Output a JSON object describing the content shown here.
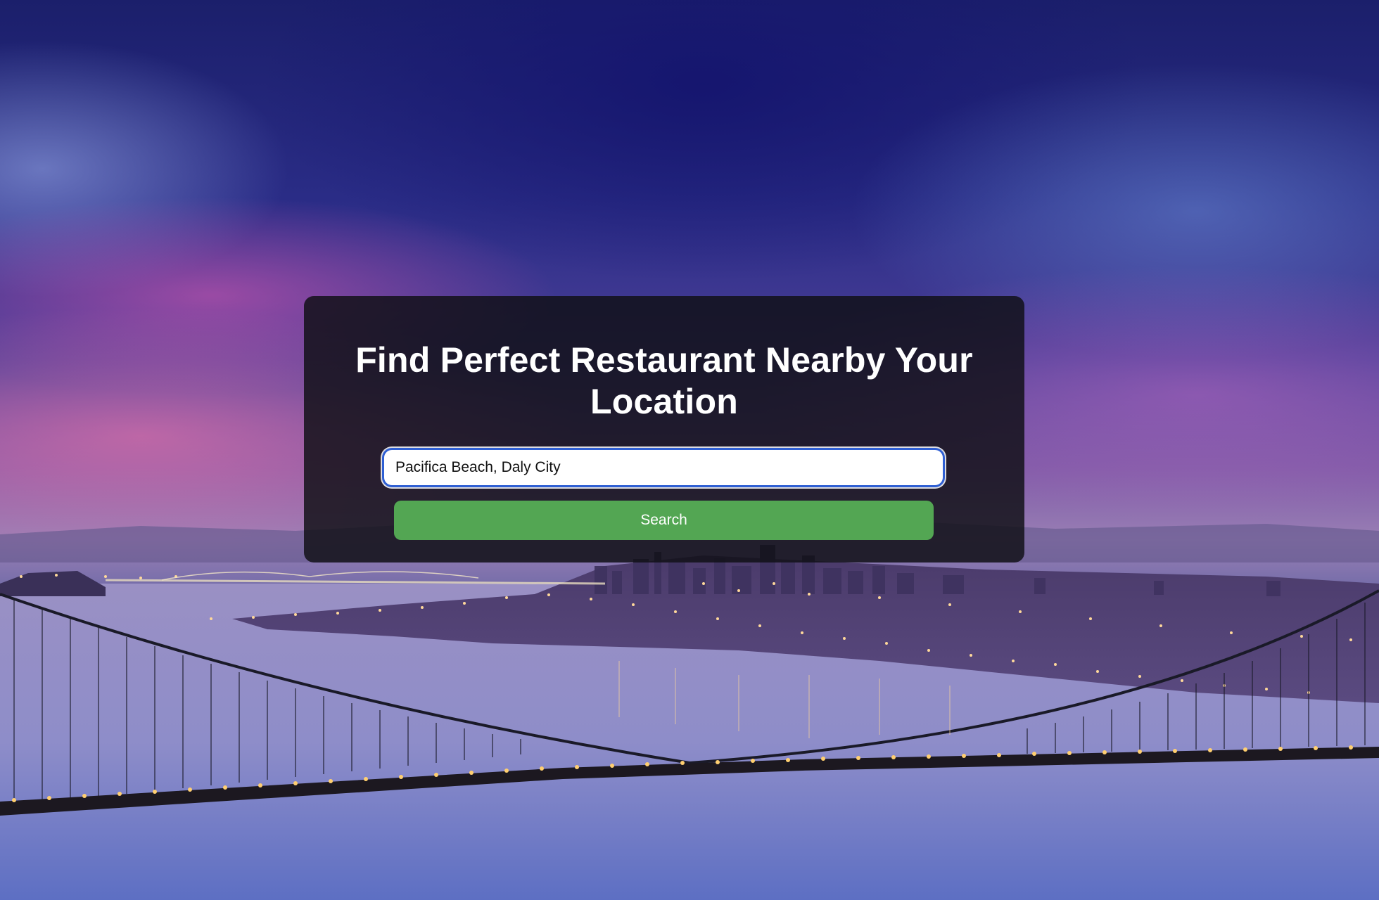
{
  "page": {
    "background": "night-city-bridge-photo"
  },
  "card": {
    "title": "Find Perfect Restaurant Nearby Your Location",
    "search_value": "Pacifica Beach, Daly City",
    "search_button_label": "Search"
  },
  "colors": {
    "card_bg": "#0f0f14",
    "button_green": "#53a653",
    "input_border": "#2f5fd3",
    "title_text": "#ffffff"
  }
}
